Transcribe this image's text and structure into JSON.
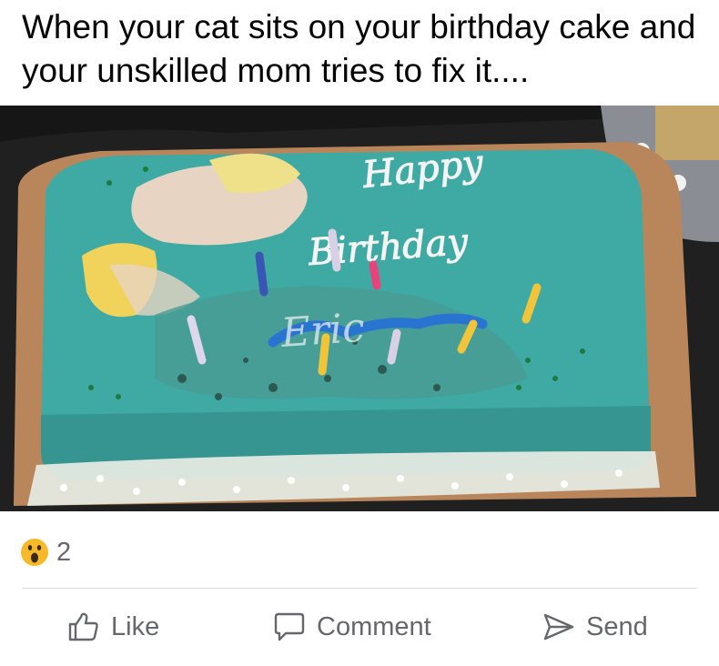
{
  "post": {
    "caption": "When your cat sits on your birthday cake and your unskilled mom tries to fix it....",
    "photo_icing_text": "Happy Birthday Eric"
  },
  "reactions": {
    "emoji": "wow-emoji-icon",
    "count": "2"
  },
  "actions": {
    "like_label": "Like",
    "comment_label": "Comment",
    "send_label": "Send"
  },
  "colors": {
    "icing": "#3fa9a4",
    "text_secondary": "#65676b",
    "reaction": "#f7b928"
  }
}
